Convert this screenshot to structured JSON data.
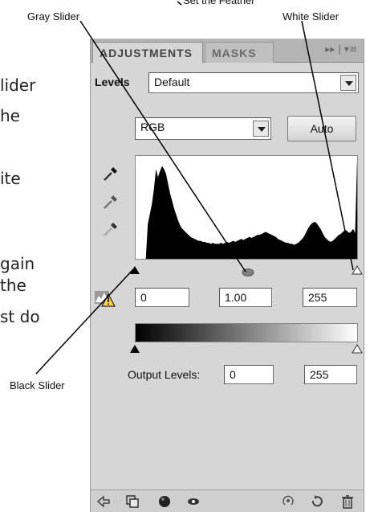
{
  "callouts": {
    "set_feather": "Set the Feather",
    "gray_slider": "Gray Slider",
    "white_slider": "White Slider",
    "black_slider": "Black Slider"
  },
  "bodytext": [
    "lider",
    "he",
    "ite",
    "gain",
    "the",
    "st do"
  ],
  "panel": {
    "tabs": [
      "ADJUSTMENTS",
      "MASKS"
    ],
    "menu_glyph": "▸▸ | ▾≡",
    "levels_label": "Levels",
    "preset_value": "Default",
    "channel_value": "RGB",
    "auto_label": "Auto",
    "input_black": "0",
    "input_gray": "1.00",
    "input_white": "255",
    "output_label": "Output Levels:",
    "output_black": "0",
    "output_white": "255"
  },
  "histogram": {
    "values": [
      0,
      0,
      0,
      0,
      0,
      0,
      0.35,
      0.45,
      0.55,
      0.7,
      0.9,
      0.82,
      0.88,
      0.93,
      0.9,
      0.85,
      0.75,
      0.65,
      0.58,
      0.5,
      0.44,
      0.38,
      0.33,
      0.3,
      0.28,
      0.26,
      0.24,
      0.22,
      0.21,
      0.2,
      0.19,
      0.18,
      0.18,
      0.17,
      0.17,
      0.16,
      0.16,
      0.15,
      0.16,
      0.15,
      0.15,
      0.15,
      0.16,
      0.15,
      0.16,
      0.17,
      0.16,
      0.17,
      0.18,
      0.17,
      0.18,
      0.19,
      0.2,
      0.19,
      0.2,
      0.21,
      0.22,
      0.21,
      0.22,
      0.23,
      0.24,
      0.24,
      0.25,
      0.26,
      0.27,
      0.26,
      0.25,
      0.24,
      0.23,
      0.22,
      0.2,
      0.19,
      0.18,
      0.17,
      0.16,
      0.16,
      0.15,
      0.15,
      0.14,
      0.15,
      0.16,
      0.18,
      0.2,
      0.23,
      0.27,
      0.31,
      0.34,
      0.36,
      0.37,
      0.36,
      0.33,
      0.3,
      0.26,
      0.22,
      0.2,
      0.18,
      0.17,
      0.18,
      0.2,
      0.22,
      0.24,
      0.25,
      0.27,
      0.29,
      0.28,
      0.26,
      0.27,
      0.3,
      0.26,
      1.0
    ]
  },
  "colors": {
    "panel_bg": "#d6d6d6",
    "histogram_fill": "#000000"
  }
}
